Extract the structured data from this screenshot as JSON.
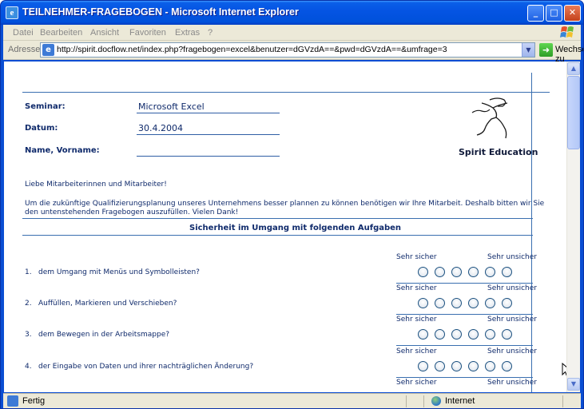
{
  "window": {
    "title": "TEILNEHMER-FRAGEBOGEN - Microsoft Internet Explorer",
    "minimize": "_",
    "maximize": "□",
    "close": "✕"
  },
  "menu": [
    "Datei",
    "Bearbeiten",
    "Ansicht",
    "Favoriten",
    "Extras",
    "?"
  ],
  "address": {
    "label": "Adresse",
    "url": "http://spirit.docflow.net/index.php?fragebogen=excel&benutzer=dGVzdA==&pwd=dGVzdA==&umfrage=3",
    "go_label": "Wechseln zu"
  },
  "form": {
    "seminar_label": "Seminar:",
    "seminar_value": "Microsoft Excel",
    "datum_label": "Datum:",
    "datum_value": "30.4.2004",
    "name_label": "Name, Vorname:",
    "name_value": ""
  },
  "logo": {
    "text": "Spirit Education"
  },
  "intro": {
    "greeting": "Liebe Mitarbeiterinnen und Mitarbeiter!",
    "line1": "Um die zukünftige Qualifizierungsplanung unseres Unternehmens besser plannen zu können benötigen wir Ihre Mitarbeit. Deshalb bitten wir Sie",
    "line2": "den untenstehenden Fragebogen auszufüllen. Vielen Dank!"
  },
  "section_title": "Sicherheit im Umgang mit folgenden Aufgaben",
  "scale": {
    "left": "Sehr sicher",
    "right": "Sehr unsicher"
  },
  "questions": [
    {
      "num": "1.",
      "text": "dem Umgang mit Menüs und Symbolleisten?"
    },
    {
      "num": "2.",
      "text": "Auffüllen, Markieren und Verschieben?"
    },
    {
      "num": "3.",
      "text": "dem Bewegen in der Arbeitsmappe?"
    },
    {
      "num": "4.",
      "text": "der Eingabe von Daten und ihrer nachträglichen Änderung?"
    }
  ],
  "status": {
    "text": "Fertig",
    "zone": "Internet"
  },
  "colors": {
    "accent": "#0f2a6b",
    "rule": "#3a6fb0",
    "titlebar": "#0554e3"
  }
}
